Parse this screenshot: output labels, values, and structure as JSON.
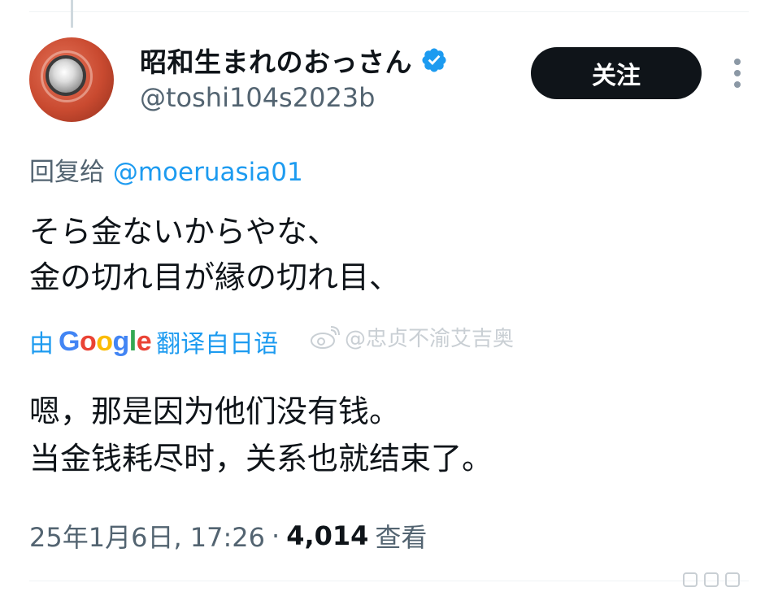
{
  "author": {
    "display_name": "昭和生まれのおっさん",
    "handle": "@toshi104s2023b"
  },
  "actions": {
    "follow_label": "关注"
  },
  "reply": {
    "prefix": "回复给 ",
    "mention": "@moeruasia01"
  },
  "tweet": {
    "line1": "そら金ないからやな、",
    "line2": "金の切れ目が縁の切れ目、"
  },
  "translation": {
    "by": "由",
    "provider": "Google",
    "from": "翻译自日语",
    "line1": "嗯，那是因为他们没有钱。",
    "line2": "当金钱耗尽时，关系也就结束了。"
  },
  "watermark": {
    "text": "@忠贞不渝艾吉奥"
  },
  "meta": {
    "datetime": "25年1月6日, 17:26",
    "separator": "·",
    "views_count": "4,014",
    "views_label": "查看"
  },
  "colors": {
    "link": "#1d9bf0",
    "text": "#0f1419",
    "secondary": "#536471",
    "button_bg": "#0f1419"
  },
  "icons": [
    "verified-badge-icon",
    "more-options-icon",
    "weibo-icon"
  ]
}
